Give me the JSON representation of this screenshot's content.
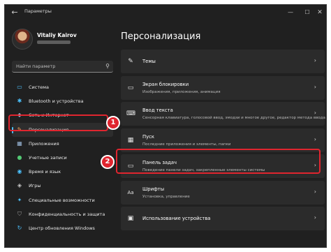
{
  "window": {
    "title": "Параметры",
    "back_icon": "←",
    "controls": {
      "minimize": "—",
      "maximize": "☐",
      "close": "✕"
    }
  },
  "profile": {
    "name": "Vitaliy Kairov"
  },
  "search": {
    "placeholder": "Найти параметр",
    "icon": "⚲"
  },
  "sidebar": {
    "items": [
      {
        "label": "Система",
        "icon": "system-icon",
        "glyph": "▭",
        "color": "#4cc2ff",
        "active": false
      },
      {
        "label": "Bluetooth и устройства",
        "icon": "bluetooth-icon",
        "glyph": "✱",
        "color": "#4cc2ff",
        "active": false
      },
      {
        "label": "Сеть и Интернет",
        "icon": "network-icon",
        "glyph": "◆",
        "color": "#9ab8d8",
        "active": false
      },
      {
        "label": "Персонализация",
        "icon": "brush-icon",
        "glyph": "✎",
        "color": "#f2a257",
        "active": true
      },
      {
        "label": "Приложения",
        "icon": "apps-icon",
        "glyph": "▦",
        "color": "#9ab8d8",
        "active": false
      },
      {
        "label": "Учетные записи",
        "icon": "accounts-icon",
        "glyph": "●",
        "color": "#52c773",
        "active": false
      },
      {
        "label": "Время и язык",
        "icon": "globe-icon",
        "glyph": "◉",
        "color": "#4cc2ff",
        "active": false
      },
      {
        "label": "Игры",
        "icon": "gamepad-icon",
        "glyph": "◈",
        "color": "#c8c8c8",
        "active": false
      },
      {
        "label": "Специальные возможности",
        "icon": "accessibility-icon",
        "glyph": "✦",
        "color": "#4cc2ff",
        "active": false
      },
      {
        "label": "Конфиденциальность и защита",
        "icon": "shield-icon",
        "glyph": "⛉",
        "color": "#9a9a9a",
        "active": false
      },
      {
        "label": "Центр обновления Windows",
        "icon": "update-icon",
        "glyph": "↻",
        "color": "#4cc2ff",
        "active": false
      }
    ]
  },
  "main": {
    "title": "Персонализация",
    "cards": [
      {
        "title": "Темы",
        "description": "",
        "icon": "themes-icon",
        "glyph": "✎"
      },
      {
        "title": "Экран блокировки",
        "description": "Изображения, приложения, анимация",
        "icon": "lock-screen-icon",
        "glyph": "▭"
      },
      {
        "title": "Ввод текста",
        "description": "Сенсорная клавиатура, голосовой ввод, эмодзи и многое другое, редактор метода ввода",
        "icon": "keyboard-icon",
        "glyph": "⌨"
      },
      {
        "title": "Пуск",
        "description": "Последние приложения и элементы, папки",
        "icon": "start-icon",
        "glyph": "▦"
      },
      {
        "title": "Панель задач",
        "description": "Поведение панели задач, закрепленные элементы системы",
        "icon": "taskbar-icon",
        "glyph": "▭"
      },
      {
        "title": "Шрифты",
        "description": "Установка, управление",
        "icon": "fonts-icon",
        "glyph": "Aa"
      },
      {
        "title": "Использование устройства",
        "description": "",
        "icon": "device-usage-icon",
        "glyph": "▣"
      }
    ],
    "chevron": "›"
  },
  "annotations": {
    "badge_1": "1",
    "badge_2": "2",
    "highlight_color": "#e0252f"
  },
  "colors": {
    "window_bg": "#202020",
    "card_bg": "#2b2b2b",
    "accent": "#4cc2ff"
  }
}
